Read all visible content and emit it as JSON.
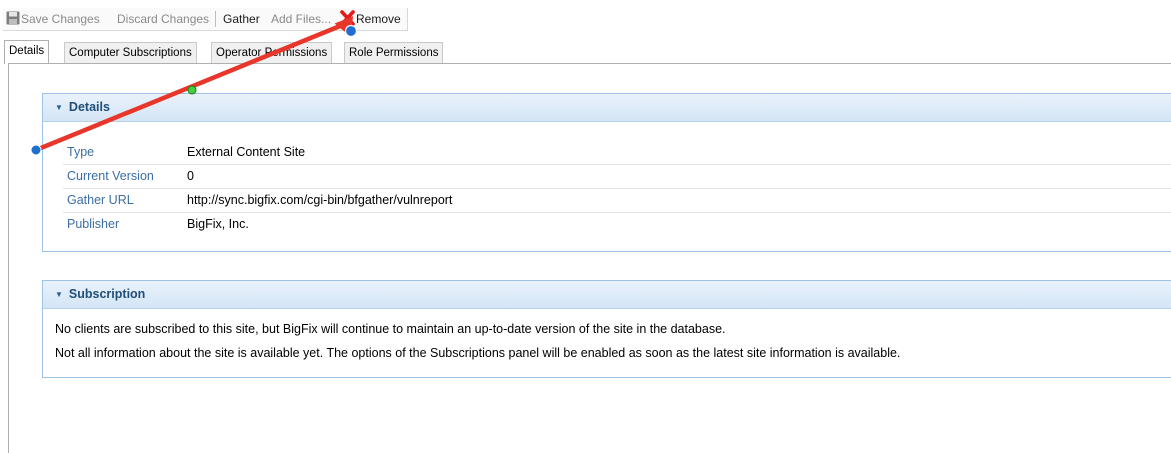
{
  "toolbar": {
    "save_label": "Save Changes",
    "discard_label": "Discard Changes",
    "gather_label": "Gather",
    "add_files_label": "Add Files...",
    "remove_label": "Remove"
  },
  "tabs": [
    {
      "label": "Details",
      "active": true
    },
    {
      "label": "Computer Subscriptions",
      "active": false
    },
    {
      "label": "Operator Permissions",
      "active": false
    },
    {
      "label": "Role Permissions",
      "active": false
    }
  ],
  "details_panel": {
    "title": "Details",
    "rows": [
      {
        "label": "Type",
        "value": "External Content Site"
      },
      {
        "label": "Current Version",
        "value": "0"
      },
      {
        "label": "Gather URL",
        "value": "http://sync.bigfix.com/cgi-bin/bfgather/vulnreport"
      },
      {
        "label": "Publisher",
        "value": "BigFix, Inc."
      }
    ]
  },
  "subscription_panel": {
    "title": "Subscription",
    "lines": [
      "No clients are subscribed to this site, but BigFix will continue to maintain an up-to-date version of the site in the database.",
      "Not all information about the site is available yet. The options of the Subscriptions panel will be enabled as soon as the latest site information is available."
    ]
  },
  "colors": {
    "annotation_arrow": "#e8372a",
    "annotation_endpoint": "#1f6fd1",
    "annotation_midpoint": "#3fd13f",
    "panel_header_text": "#1f4e79",
    "label_text": "#3c6ea3"
  }
}
